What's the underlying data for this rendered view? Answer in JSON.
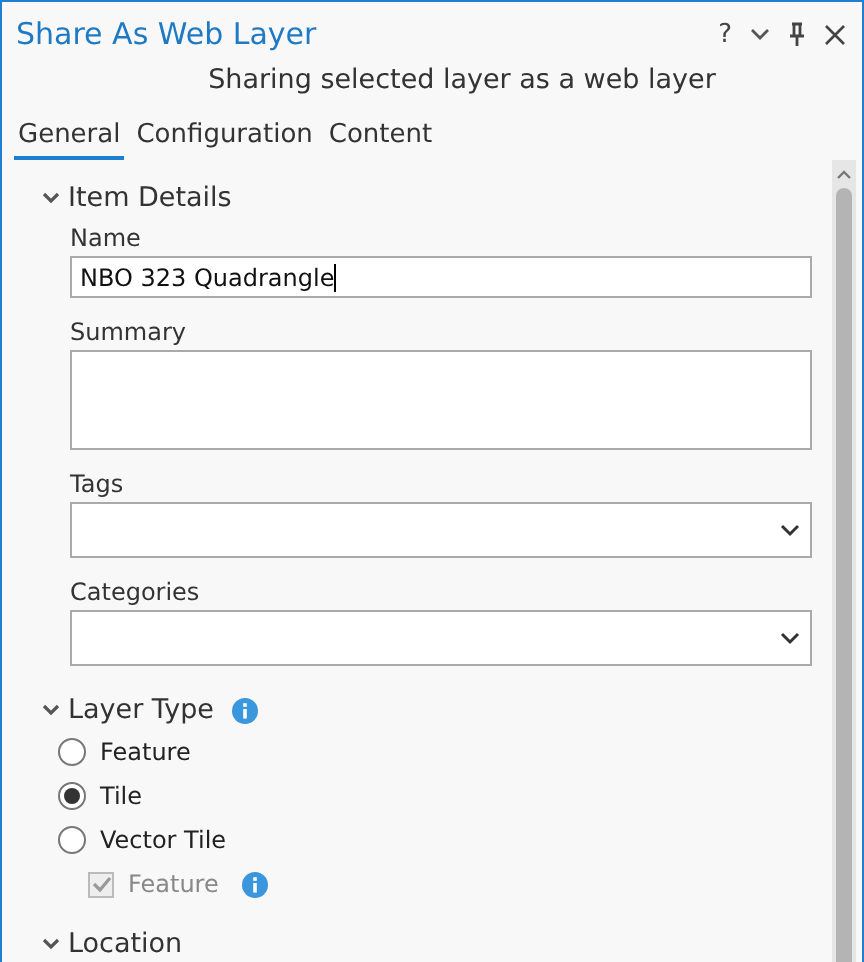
{
  "window": {
    "title": "Share As Web Layer",
    "subtitle": "Sharing selected layer as a web layer",
    "controls": [
      {
        "kind": "help",
        "label": "?"
      },
      {
        "kind": "menu"
      },
      {
        "kind": "pin"
      },
      {
        "kind": "close"
      }
    ]
  },
  "tabs": [
    {
      "label": "General",
      "selected": true
    },
    {
      "label": "Configuration",
      "selected": false
    },
    {
      "label": "Content",
      "selected": false
    }
  ],
  "item_details": {
    "title": "Item Details",
    "expanded": true,
    "fields": [
      {
        "kind": "text",
        "label": "Name",
        "value": "NBO 323 Quadrangle"
      },
      {
        "kind": "textarea",
        "label": "Summary"
      },
      {
        "kind": "dropdown",
        "label": "Tags"
      },
      {
        "kind": "dropdown",
        "label": "Categories"
      }
    ]
  },
  "layer_type": {
    "title": "Layer Type",
    "expanded": true,
    "options": [
      {
        "kind": "radio",
        "label": "Feature",
        "selected": false
      },
      {
        "kind": "radio",
        "label": "Tile",
        "selected": true
      },
      {
        "kind": "radio",
        "label": "Vector Tile",
        "selected": false
      },
      {
        "kind": "checkbox",
        "label": "Feature",
        "checked": true,
        "disabled": true,
        "info": true
      }
    ]
  },
  "location": {
    "title": "Location",
    "expanded": true
  }
}
